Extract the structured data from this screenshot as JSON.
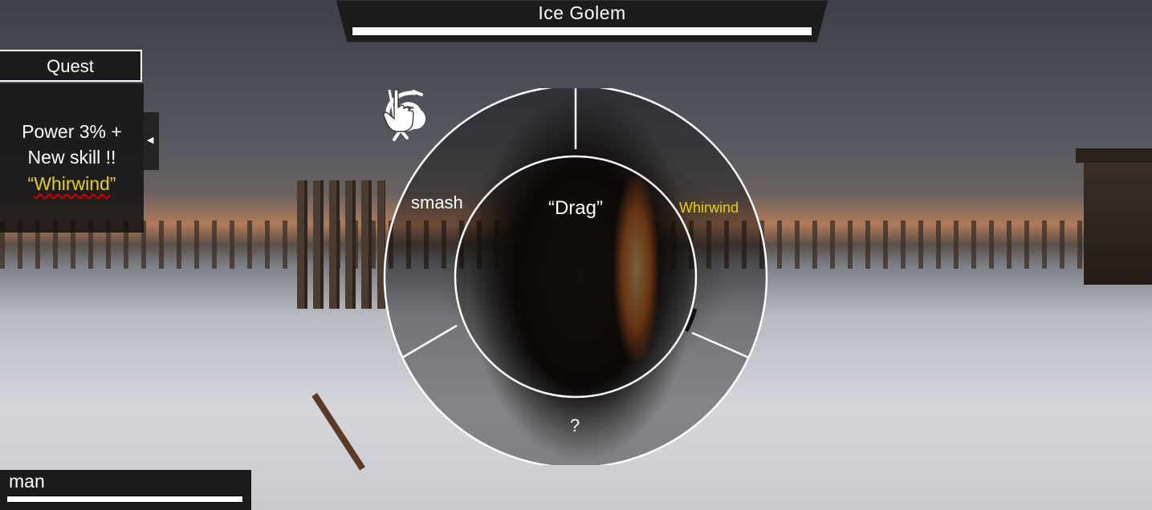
{
  "boss": {
    "name": "Ice Golem",
    "health_fraction": 1.0
  },
  "quest": {
    "title": "Quest",
    "line1": "Power 3% +",
    "line2": "New skill !!",
    "skill_open_quote": "“",
    "skill_name": "Whirwind",
    "skill_close_quote": "”",
    "collapse_glyph": "◀"
  },
  "radial_menu": {
    "center_label": "“Drag”",
    "center_icon": "pointing-hand-icon",
    "left_skill": {
      "label": "smash",
      "icon": "smash-icon"
    },
    "right_skill": {
      "label": "Whirwind",
      "icon": "whirlwind-icon",
      "color": "#e6d200"
    },
    "bottom_slot": {
      "label": "?"
    }
  },
  "player": {
    "name": "man",
    "health_fraction": 1.0
  }
}
